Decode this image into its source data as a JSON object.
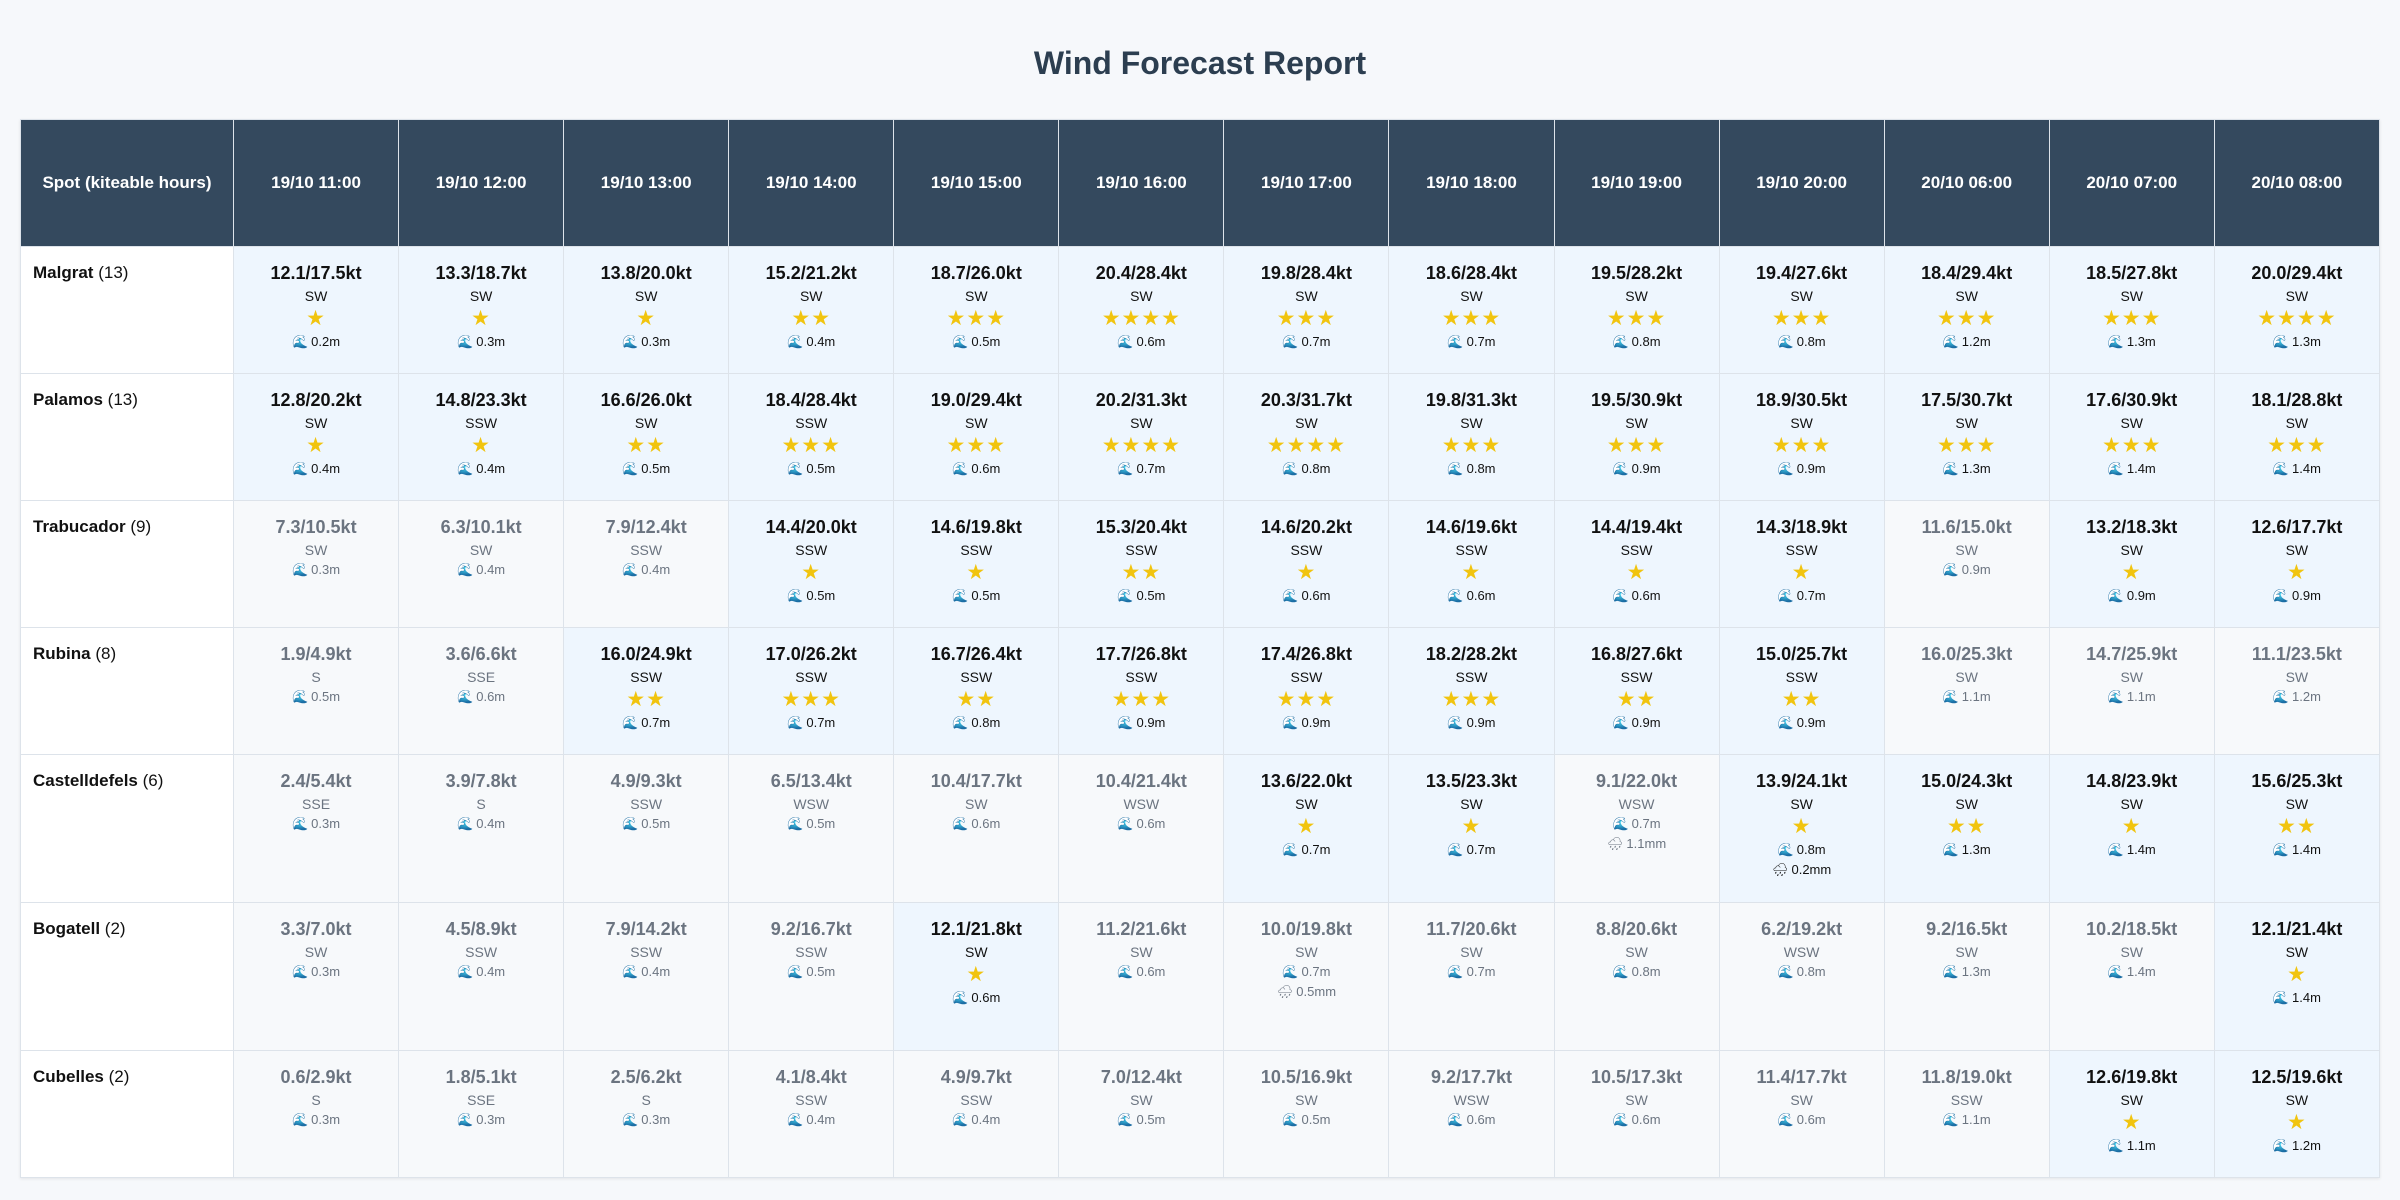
{
  "title": "Wind Forecast Report",
  "header": {
    "spot_label": "Spot (kiteable hours)",
    "times": [
      "19/10 11:00",
      "19/10 12:00",
      "19/10 13:00",
      "19/10 14:00",
      "19/10 15:00",
      "19/10 16:00",
      "19/10 17:00",
      "19/10 18:00",
      "19/10 19:00",
      "19/10 20:00",
      "20/10 06:00",
      "20/10 07:00",
      "20/10 08:00"
    ]
  },
  "icons": {
    "wave": "wave-icon",
    "rain": "rain-cloud-icon",
    "star": "star-icon"
  },
  "colors": {
    "header_bg": "#34495e",
    "kiteable_bg": "#eef6fe",
    "star": "#f1c40f",
    "muted": "#6b7480"
  },
  "rows": [
    {
      "spot": "Malgrat",
      "count": "(13)",
      "cells": [
        {
          "speed": "12.1/17.5kt",
          "dir": "SW",
          "stars": 1,
          "wave": "0.2m"
        },
        {
          "speed": "13.3/18.7kt",
          "dir": "SW",
          "stars": 1,
          "wave": "0.3m"
        },
        {
          "speed": "13.8/20.0kt",
          "dir": "SW",
          "stars": 1,
          "wave": "0.3m"
        },
        {
          "speed": "15.2/21.2kt",
          "dir": "SW",
          "stars": 2,
          "wave": "0.4m"
        },
        {
          "speed": "18.7/26.0kt",
          "dir": "SW",
          "stars": 3,
          "wave": "0.5m"
        },
        {
          "speed": "20.4/28.4kt",
          "dir": "SW",
          "stars": 4,
          "wave": "0.6m"
        },
        {
          "speed": "19.8/28.4kt",
          "dir": "SW",
          "stars": 3,
          "wave": "0.7m"
        },
        {
          "speed": "18.6/28.4kt",
          "dir": "SW",
          "stars": 3,
          "wave": "0.7m"
        },
        {
          "speed": "19.5/28.2kt",
          "dir": "SW",
          "stars": 3,
          "wave": "0.8m"
        },
        {
          "speed": "19.4/27.6kt",
          "dir": "SW",
          "stars": 3,
          "wave": "0.8m"
        },
        {
          "speed": "18.4/29.4kt",
          "dir": "SW",
          "stars": 3,
          "wave": "1.2m"
        },
        {
          "speed": "18.5/27.8kt",
          "dir": "SW",
          "stars": 3,
          "wave": "1.3m"
        },
        {
          "speed": "20.0/29.4kt",
          "dir": "SW",
          "stars": 4,
          "wave": "1.3m"
        }
      ]
    },
    {
      "spot": "Palamos",
      "count": "(13)",
      "cells": [
        {
          "speed": "12.8/20.2kt",
          "dir": "SW",
          "stars": 1,
          "wave": "0.4m"
        },
        {
          "speed": "14.8/23.3kt",
          "dir": "SSW",
          "stars": 1,
          "wave": "0.4m"
        },
        {
          "speed": "16.6/26.0kt",
          "dir": "SW",
          "stars": 2,
          "wave": "0.5m"
        },
        {
          "speed": "18.4/28.4kt",
          "dir": "SSW",
          "stars": 3,
          "wave": "0.5m"
        },
        {
          "speed": "19.0/29.4kt",
          "dir": "SW",
          "stars": 3,
          "wave": "0.6m"
        },
        {
          "speed": "20.2/31.3kt",
          "dir": "SW",
          "stars": 4,
          "wave": "0.7m"
        },
        {
          "speed": "20.3/31.7kt",
          "dir": "SW",
          "stars": 4,
          "wave": "0.8m"
        },
        {
          "speed": "19.8/31.3kt",
          "dir": "SW",
          "stars": 3,
          "wave": "0.8m"
        },
        {
          "speed": "19.5/30.9kt",
          "dir": "SW",
          "stars": 3,
          "wave": "0.9m"
        },
        {
          "speed": "18.9/30.5kt",
          "dir": "SW",
          "stars": 3,
          "wave": "0.9m"
        },
        {
          "speed": "17.5/30.7kt",
          "dir": "SW",
          "stars": 3,
          "wave": "1.3m"
        },
        {
          "speed": "17.6/30.9kt",
          "dir": "SW",
          "stars": 3,
          "wave": "1.4m"
        },
        {
          "speed": "18.1/28.8kt",
          "dir": "SW",
          "stars": 3,
          "wave": "1.4m"
        }
      ]
    },
    {
      "spot": "Trabucador",
      "count": "(9)",
      "cells": [
        {
          "speed": "7.3/10.5kt",
          "dir": "SW",
          "stars": 0,
          "wave": "0.3m"
        },
        {
          "speed": "6.3/10.1kt",
          "dir": "SW",
          "stars": 0,
          "wave": "0.4m"
        },
        {
          "speed": "7.9/12.4kt",
          "dir": "SSW",
          "stars": 0,
          "wave": "0.4m"
        },
        {
          "speed": "14.4/20.0kt",
          "dir": "SSW",
          "stars": 1,
          "wave": "0.5m"
        },
        {
          "speed": "14.6/19.8kt",
          "dir": "SSW",
          "stars": 1,
          "wave": "0.5m"
        },
        {
          "speed": "15.3/20.4kt",
          "dir": "SSW",
          "stars": 2,
          "wave": "0.5m"
        },
        {
          "speed": "14.6/20.2kt",
          "dir": "SSW",
          "stars": 1,
          "wave": "0.6m"
        },
        {
          "speed": "14.6/19.6kt",
          "dir": "SSW",
          "stars": 1,
          "wave": "0.6m"
        },
        {
          "speed": "14.4/19.4kt",
          "dir": "SSW",
          "stars": 1,
          "wave": "0.6m"
        },
        {
          "speed": "14.3/18.9kt",
          "dir": "SSW",
          "stars": 1,
          "wave": "0.7m"
        },
        {
          "speed": "11.6/15.0kt",
          "dir": "SW",
          "stars": 0,
          "wave": "0.9m"
        },
        {
          "speed": "13.2/18.3kt",
          "dir": "SW",
          "stars": 1,
          "wave": "0.9m"
        },
        {
          "speed": "12.6/17.7kt",
          "dir": "SW",
          "stars": 1,
          "wave": "0.9m"
        }
      ]
    },
    {
      "spot": "Rubina",
      "count": "(8)",
      "cells": [
        {
          "speed": "1.9/4.9kt",
          "dir": "S",
          "stars": 0,
          "wave": "0.5m"
        },
        {
          "speed": "3.6/6.6kt",
          "dir": "SSE",
          "stars": 0,
          "wave": "0.6m"
        },
        {
          "speed": "16.0/24.9kt",
          "dir": "SSW",
          "stars": 2,
          "wave": "0.7m"
        },
        {
          "speed": "17.0/26.2kt",
          "dir": "SSW",
          "stars": 3,
          "wave": "0.7m"
        },
        {
          "speed": "16.7/26.4kt",
          "dir": "SSW",
          "stars": 2,
          "wave": "0.8m"
        },
        {
          "speed": "17.7/26.8kt",
          "dir": "SSW",
          "stars": 3,
          "wave": "0.9m"
        },
        {
          "speed": "17.4/26.8kt",
          "dir": "SSW",
          "stars": 3,
          "wave": "0.9m"
        },
        {
          "speed": "18.2/28.2kt",
          "dir": "SSW",
          "stars": 3,
          "wave": "0.9m"
        },
        {
          "speed": "16.8/27.6kt",
          "dir": "SSW",
          "stars": 2,
          "wave": "0.9m"
        },
        {
          "speed": "15.0/25.7kt",
          "dir": "SSW",
          "stars": 2,
          "wave": "0.9m"
        },
        {
          "speed": "16.0/25.3kt",
          "dir": "SW",
          "stars": 0,
          "wave": "1.1m"
        },
        {
          "speed": "14.7/25.9kt",
          "dir": "SW",
          "stars": 0,
          "wave": "1.1m"
        },
        {
          "speed": "11.1/23.5kt",
          "dir": "SW",
          "stars": 0,
          "wave": "1.2m"
        }
      ]
    },
    {
      "spot": "Castelldefels",
      "count": "(6)",
      "cells": [
        {
          "speed": "2.4/5.4kt",
          "dir": "SSE",
          "stars": 0,
          "wave": "0.3m"
        },
        {
          "speed": "3.9/7.8kt",
          "dir": "S",
          "stars": 0,
          "wave": "0.4m"
        },
        {
          "speed": "4.9/9.3kt",
          "dir": "SSW",
          "stars": 0,
          "wave": "0.5m"
        },
        {
          "speed": "6.5/13.4kt",
          "dir": "WSW",
          "stars": 0,
          "wave": "0.5m"
        },
        {
          "speed": "10.4/17.7kt",
          "dir": "SW",
          "stars": 0,
          "wave": "0.6m"
        },
        {
          "speed": "10.4/21.4kt",
          "dir": "WSW",
          "stars": 0,
          "wave": "0.6m"
        },
        {
          "speed": "13.6/22.0kt",
          "dir": "SW",
          "stars": 1,
          "wave": "0.7m"
        },
        {
          "speed": "13.5/23.3kt",
          "dir": "SW",
          "stars": 1,
          "wave": "0.7m"
        },
        {
          "speed": "9.1/22.0kt",
          "dir": "WSW",
          "stars": 0,
          "wave": "0.7m",
          "rain": "1.1mm"
        },
        {
          "speed": "13.9/24.1kt",
          "dir": "SW",
          "stars": 1,
          "wave": "0.8m",
          "rain": "0.2mm"
        },
        {
          "speed": "15.0/24.3kt",
          "dir": "SW",
          "stars": 2,
          "wave": "1.3m"
        },
        {
          "speed": "14.8/23.9kt",
          "dir": "SW",
          "stars": 1,
          "wave": "1.4m"
        },
        {
          "speed": "15.6/25.3kt",
          "dir": "SW",
          "stars": 2,
          "wave": "1.4m"
        }
      ]
    },
    {
      "spot": "Bogatell",
      "count": "(2)",
      "cells": [
        {
          "speed": "3.3/7.0kt",
          "dir": "SW",
          "stars": 0,
          "wave": "0.3m"
        },
        {
          "speed": "4.5/8.9kt",
          "dir": "SSW",
          "stars": 0,
          "wave": "0.4m"
        },
        {
          "speed": "7.9/14.2kt",
          "dir": "SSW",
          "stars": 0,
          "wave": "0.4m"
        },
        {
          "speed": "9.2/16.7kt",
          "dir": "SSW",
          "stars": 0,
          "wave": "0.5m"
        },
        {
          "speed": "12.1/21.8kt",
          "dir": "SW",
          "stars": 1,
          "wave": "0.6m"
        },
        {
          "speed": "11.2/21.6kt",
          "dir": "SW",
          "stars": 0,
          "wave": "0.6m"
        },
        {
          "speed": "10.0/19.8kt",
          "dir": "SW",
          "stars": 0,
          "wave": "0.7m",
          "rain": "0.5mm"
        },
        {
          "speed": "11.7/20.6kt",
          "dir": "SW",
          "stars": 0,
          "wave": "0.7m"
        },
        {
          "speed": "8.8/20.6kt",
          "dir": "SW",
          "stars": 0,
          "wave": "0.8m"
        },
        {
          "speed": "6.2/19.2kt",
          "dir": "WSW",
          "stars": 0,
          "wave": "0.8m"
        },
        {
          "speed": "9.2/16.5kt",
          "dir": "SW",
          "stars": 0,
          "wave": "1.3m"
        },
        {
          "speed": "10.2/18.5kt",
          "dir": "SW",
          "stars": 0,
          "wave": "1.4m"
        },
        {
          "speed": "12.1/21.4kt",
          "dir": "SW",
          "stars": 1,
          "wave": "1.4m"
        }
      ]
    },
    {
      "spot": "Cubelles",
      "count": "(2)",
      "cells": [
        {
          "speed": "0.6/2.9kt",
          "dir": "S",
          "stars": 0,
          "wave": "0.3m"
        },
        {
          "speed": "1.8/5.1kt",
          "dir": "SSE",
          "stars": 0,
          "wave": "0.3m"
        },
        {
          "speed": "2.5/6.2kt",
          "dir": "S",
          "stars": 0,
          "wave": "0.3m"
        },
        {
          "speed": "4.1/8.4kt",
          "dir": "SSW",
          "stars": 0,
          "wave": "0.4m"
        },
        {
          "speed": "4.9/9.7kt",
          "dir": "SSW",
          "stars": 0,
          "wave": "0.4m"
        },
        {
          "speed": "7.0/12.4kt",
          "dir": "SW",
          "stars": 0,
          "wave": "0.5m"
        },
        {
          "speed": "10.5/16.9kt",
          "dir": "SW",
          "stars": 0,
          "wave": "0.5m"
        },
        {
          "speed": "9.2/17.7kt",
          "dir": "WSW",
          "stars": 0,
          "wave": "0.6m"
        },
        {
          "speed": "10.5/17.3kt",
          "dir": "SW",
          "stars": 0,
          "wave": "0.6m"
        },
        {
          "speed": "11.4/17.7kt",
          "dir": "SW",
          "stars": 0,
          "wave": "0.6m"
        },
        {
          "speed": "11.8/19.0kt",
          "dir": "SSW",
          "stars": 0,
          "wave": "1.1m"
        },
        {
          "speed": "12.6/19.8kt",
          "dir": "SW",
          "stars": 1,
          "wave": "1.1m"
        },
        {
          "speed": "12.5/19.6kt",
          "dir": "SW",
          "stars": 1,
          "wave": "1.2m"
        }
      ]
    }
  ]
}
